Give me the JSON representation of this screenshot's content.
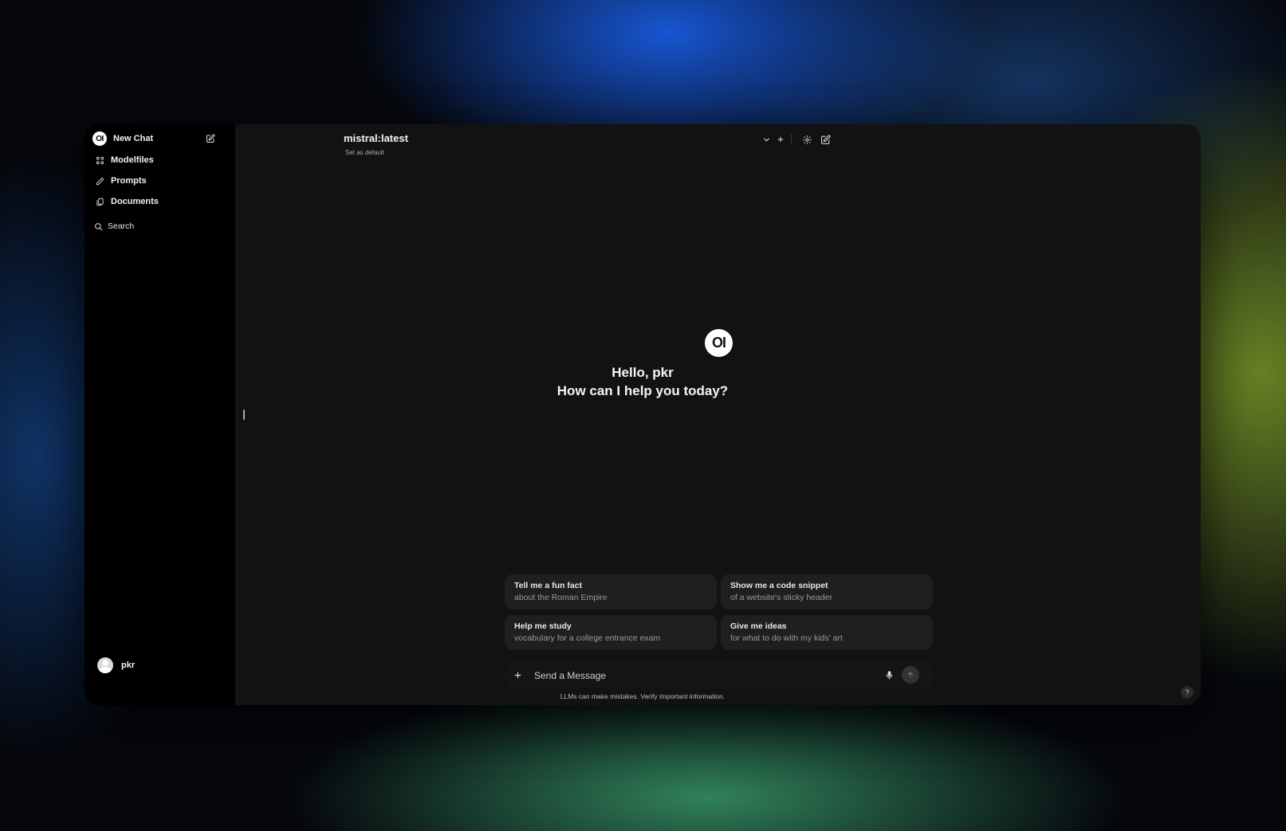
{
  "sidebar": {
    "logo_text": "OI",
    "new_chat_label": "New Chat",
    "items": [
      {
        "label": "Modelfiles",
        "icon": "modelfiles-icon"
      },
      {
        "label": "Prompts",
        "icon": "pencil-icon"
      },
      {
        "label": "Documents",
        "icon": "documents-icon"
      }
    ],
    "search_label": "Search",
    "user": {
      "name": "pkr"
    }
  },
  "header": {
    "model_name": "mistral:latest",
    "set_default_label": "Set as default"
  },
  "welcome": {
    "logo_text": "OI",
    "greeting": "Hello, pkr",
    "subtitle": "How can I help you today?"
  },
  "suggestions": [
    {
      "title": "Tell me a fun fact",
      "subtitle": "about the Roman Empire"
    },
    {
      "title": "Show me a code snippet",
      "subtitle": "of a website's sticky header"
    },
    {
      "title": "Help me study",
      "subtitle": "vocabulary for a college entrance exam"
    },
    {
      "title": "Give me ideas",
      "subtitle": "for what to do with my kids' art"
    }
  ],
  "composer": {
    "placeholder": "Send a Message"
  },
  "footer": {
    "disclaimer": "LLMs can make mistakes. Verify important information.",
    "help_label": "?"
  },
  "colors": {
    "window_bg": "#121212",
    "sidebar_bg": "#000000",
    "card_bg": "#1f1f1f"
  }
}
